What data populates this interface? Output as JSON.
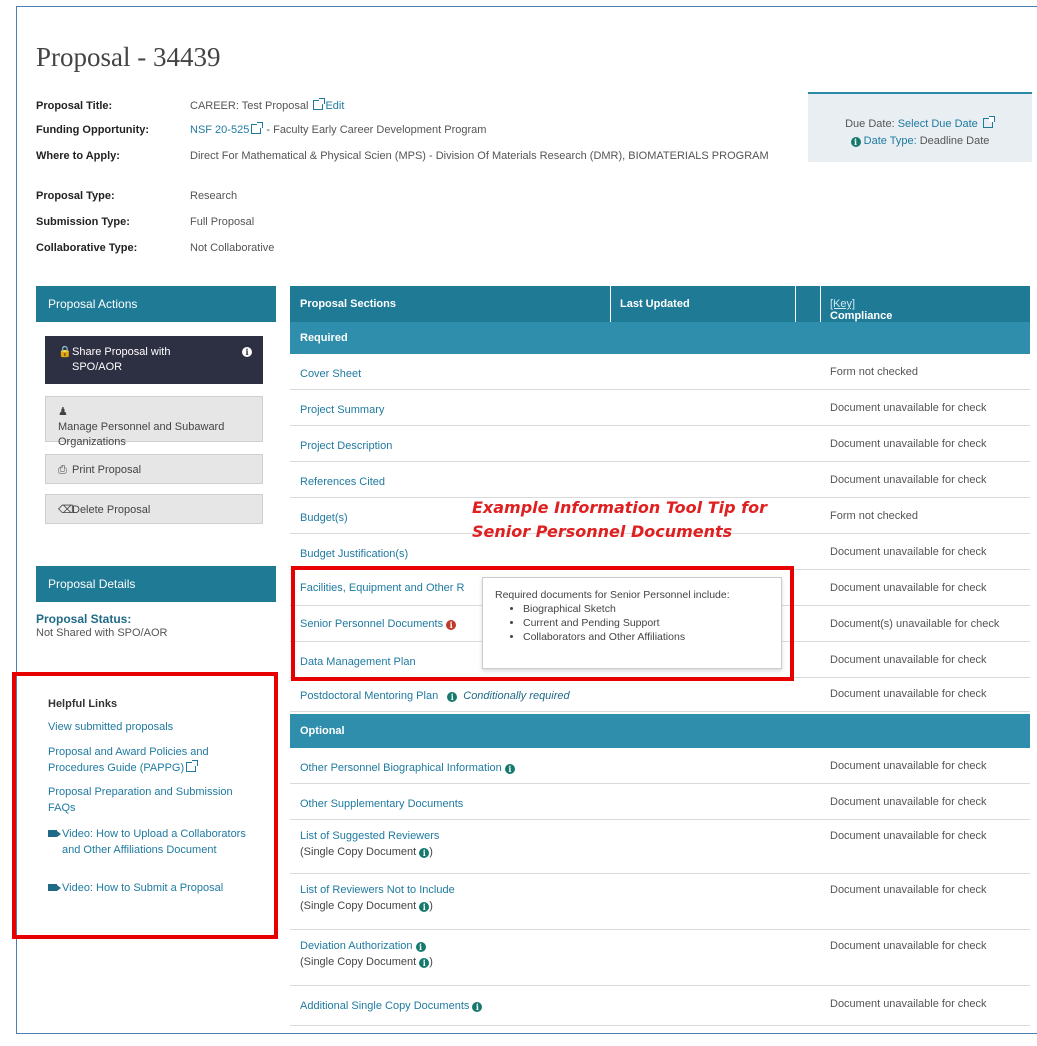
{
  "page_title": "Proposal - 34439",
  "meta": [
    {
      "label": "Proposal Title:",
      "value": "CAREER: Test Proposal",
      "link": "Edit"
    },
    {
      "label": "Funding Opportunity:",
      "link": "NSF 20-525",
      "value": "- Faculty Early Career Development Program"
    },
    {
      "label": "Where to Apply:",
      "value": "Direct For Mathematical & Physical Scien (MPS) - Division Of Materials Research (DMR), BIOMATERIALS PROGRAM"
    },
    {
      "label": "Proposal Type:",
      "value": "Research"
    },
    {
      "label": "Submission Type:",
      "value": "Full Proposal"
    },
    {
      "label": "Collaborative Type:",
      "value": "Not Collaborative"
    }
  ],
  "due": {
    "label": "Due Date:",
    "link": "Select Due Date",
    "type_label": "Date Type:",
    "type_value": "Deadline Date"
  },
  "actions": {
    "title": "Proposal Actions",
    "share": "Share Proposal with SPO/AOR",
    "manage": "Manage Personnel and Subaward Organizations",
    "print": "Print Proposal",
    "delete": "Delete Proposal"
  },
  "details": {
    "title": "Proposal Details",
    "status_label": "Proposal Status:",
    "status_value": "Not Shared with SPO/AOR"
  },
  "helpful": {
    "title": "Helpful Links",
    "links": [
      "View submitted proposals",
      "Proposal and Award Policies and Procedures Guide (PAPPG)",
      "Proposal Preparation and Submission FAQs",
      "Video: How to Upload a Collaborators and Other Affiliations Document",
      "Video: How to Submit a Proposal"
    ]
  },
  "table": {
    "headers": {
      "sections": "Proposal Sections",
      "updated": "Last Updated",
      "status": "Compliance Status",
      "key": "[Key]"
    },
    "required_label": "Required",
    "optional_label": "Optional",
    "required": [
      {
        "name": "Cover Sheet",
        "status": "Form not checked"
      },
      {
        "name": "Project Summary",
        "status": "Document unavailable for check"
      },
      {
        "name": "Project Description",
        "status": "Document unavailable for check"
      },
      {
        "name": "References Cited",
        "status": "Document unavailable for check"
      },
      {
        "name": "Budget(s)",
        "status": "Form not checked"
      },
      {
        "name": "Budget Justification(s)",
        "status": "Document unavailable for check"
      },
      {
        "name": "Facilities, Equipment and Other R",
        "status": "Document unavailable for check"
      },
      {
        "name": "Senior Personnel Documents",
        "status": "Document(s) unavailable for check"
      },
      {
        "name": "Data Management Plan",
        "status": "Document unavailable for check"
      },
      {
        "name": "Postdoctoral Mentoring Plan",
        "note": "Conditionally required",
        "status": "Document unavailable for check"
      }
    ],
    "optional": [
      {
        "name": "Other Personnel Biographical Information",
        "status": "Document unavailable for check"
      },
      {
        "name": "Other Supplementary Documents",
        "status": "Document unavailable for check"
      },
      {
        "name": "List of Suggested Reviewers",
        "sub": "(Single Copy Document",
        "status": "Document unavailable for check"
      },
      {
        "name": "List of Reviewers Not to Include",
        "sub": "(Single Copy Document",
        "status": "Document unavailable for check"
      },
      {
        "name": "Deviation Authorization",
        "sub": "(Single Copy Document",
        "status": "Document unavailable for check"
      },
      {
        "name": "Additional Single Copy Documents",
        "status": "Document unavailable for check"
      }
    ]
  },
  "tooltip": {
    "intro": "Required documents for Senior Personnel include:",
    "items": [
      "Biographical Sketch",
      "Current and Pending Support",
      "Collaborators and Other Affiliations"
    ]
  },
  "annotation": {
    "line1": "Example Information Tool Tip for",
    "line2": "Senior Personnel Documents"
  }
}
